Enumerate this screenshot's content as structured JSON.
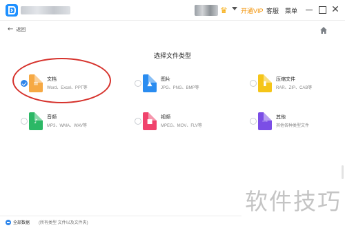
{
  "titlebar": {
    "vip_label": "开通VIP",
    "service_label": "客服",
    "menu_label": "菜单",
    "close_glyph": "✕",
    "crown_glyph": "♛"
  },
  "nav": {
    "back_label": "返回",
    "back_glyph": "←"
  },
  "page_title": "选择文件类型",
  "file_types": [
    {
      "name": "文档",
      "desc": "Word、Excel、PPT等",
      "color": "#f6a944",
      "glyph": "≡",
      "icon": "document-icon",
      "selected": true
    },
    {
      "name": "图片",
      "desc": "JPG、PNG、BMP等",
      "color": "#2a8cf0",
      "glyph": "▲",
      "icon": "image-icon",
      "selected": false
    },
    {
      "name": "压缩文件",
      "desc": "RAR、ZIP、CAB等",
      "color": "#f5c518",
      "glyph": "▮",
      "icon": "archive-icon",
      "selected": false
    },
    {
      "name": "音频",
      "desc": "MP3、WMA、WAV等",
      "color": "#2cb866",
      "glyph": "♪",
      "icon": "audio-icon",
      "selected": false
    },
    {
      "name": "视频",
      "desc": "MPEG、MOV、FLV等",
      "color": "#f0436c",
      "glyph": "■",
      "icon": "video-icon",
      "selected": false
    },
    {
      "name": "其他",
      "desc": "其他各种类型文件",
      "color": "#7b4ee6",
      "glyph": "···",
      "icon": "other-files-icon",
      "selected": false
    }
  ],
  "bottom_bar": {
    "label": "全部数据",
    "sublabel": "(所有类型 文件以及文件夹)"
  },
  "watermark": "软件技巧",
  "colors": {
    "accent": "#2f86eb",
    "vip": "#f29000",
    "annotation": "#d6322c"
  }
}
